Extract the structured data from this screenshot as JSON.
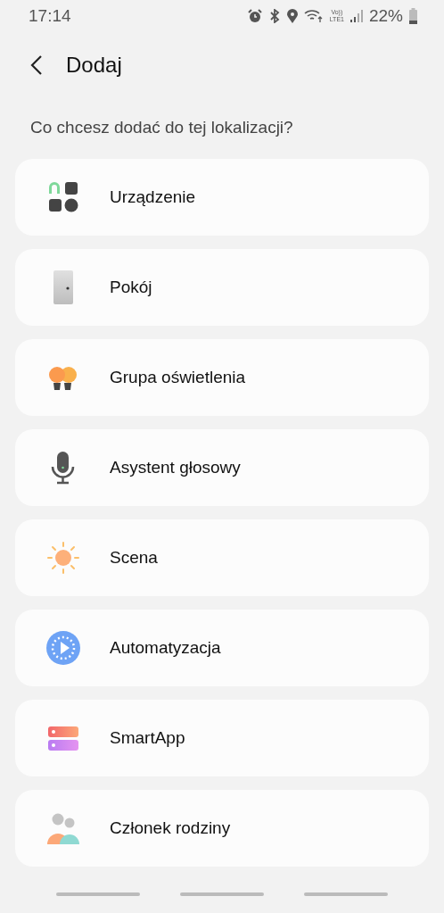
{
  "status_bar": {
    "time": "17:14",
    "network": "Vo))\nLTE1",
    "battery": "22%"
  },
  "header": {
    "title": "Dodaj"
  },
  "prompt": "Co chcesz dodać do tej lokalizacji?",
  "items": [
    {
      "kind": "device",
      "label": "Urządzenie"
    },
    {
      "kind": "room",
      "label": "Pokój"
    },
    {
      "kind": "lights",
      "label": "Grupa oświetlenia"
    },
    {
      "kind": "voice",
      "label": "Asystent głosowy"
    },
    {
      "kind": "scene",
      "label": "Scena"
    },
    {
      "kind": "automation",
      "label": "Automatyzacja"
    },
    {
      "kind": "smartapp",
      "label": "SmartApp"
    },
    {
      "kind": "member",
      "label": "Członek rodziny"
    }
  ]
}
